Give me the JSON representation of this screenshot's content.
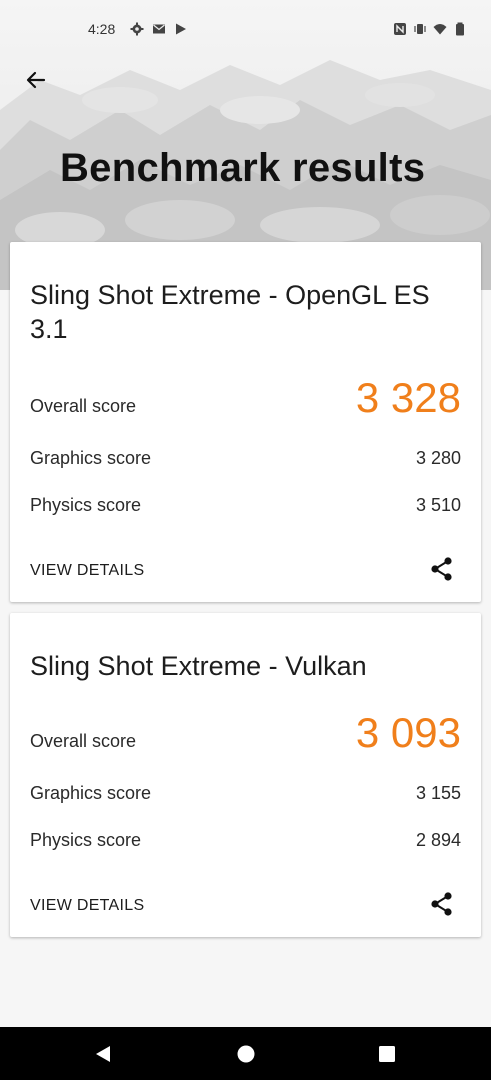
{
  "status_bar": {
    "time": "4:28",
    "left_icons": [
      "gear-icon",
      "mail-icon",
      "play-store-icon"
    ],
    "right_icons": [
      "nfc-icon",
      "vibrate-icon",
      "wifi-icon",
      "battery-icon"
    ]
  },
  "header": {
    "title": "Benchmark results",
    "back_icon": "arrow-left-icon"
  },
  "results": [
    {
      "title": "Sling Shot Extreme - OpenGL ES 3.1",
      "overall_label": "Overall score",
      "overall_value": "3 328",
      "graphics_label": "Graphics score",
      "graphics_value": "3 280",
      "physics_label": "Physics score",
      "physics_value": "3 510",
      "view_details_label": "VIEW DETAILS",
      "share_icon": "share-icon"
    },
    {
      "title": "Sling Shot Extreme - Vulkan",
      "overall_label": "Overall score",
      "overall_value": "3 093",
      "graphics_label": "Graphics score",
      "graphics_value": "3 155",
      "physics_label": "Physics score",
      "physics_value": "2 894",
      "view_details_label": "VIEW DETAILS",
      "share_icon": "share-icon"
    }
  ],
  "nav_bar": {
    "icons": [
      "back-triangle-icon",
      "home-circle-icon",
      "recents-square-icon"
    ]
  },
  "colors": {
    "accent": "#f07f1b",
    "background": "#f6f6f6",
    "nav_bar": "#000000"
  }
}
